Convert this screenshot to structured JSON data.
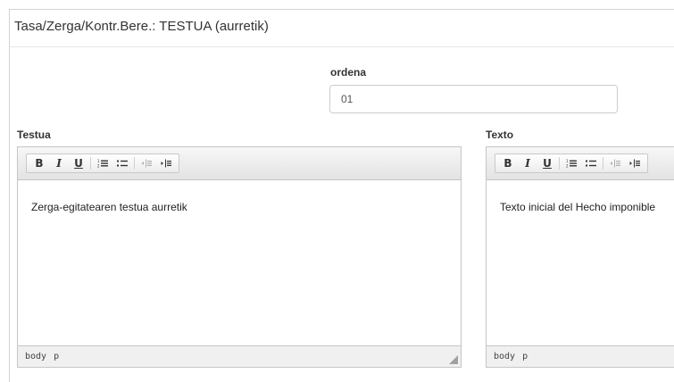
{
  "dialog": {
    "title": "Tasa/Zerga/Kontr.Bere.: TESTUA (aurretik)"
  },
  "ordena": {
    "label": "ordena",
    "value": "01"
  },
  "editors": {
    "left": {
      "label": "Testua",
      "content": "Zerga-egitatearen testua aurretik",
      "path": [
        "body",
        "p"
      ]
    },
    "right": {
      "label": "Texto",
      "content": "Texto inicial del Hecho imponible",
      "path": [
        "body",
        "p"
      ]
    }
  },
  "toolbar": {
    "bold": "B",
    "italic": "I",
    "underline": "U",
    "icons": [
      "ordered-list-icon",
      "unordered-list-icon",
      "outdent-icon",
      "indent-icon"
    ]
  }
}
